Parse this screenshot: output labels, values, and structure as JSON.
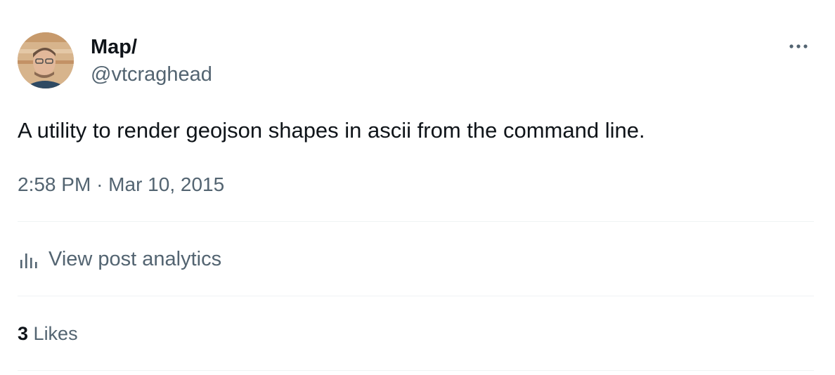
{
  "author": {
    "display_name": "Map/",
    "handle": "@vtcraghead",
    "avatar_icon": "profile-photo"
  },
  "tweet": {
    "text": "A utility to render geojson shapes in ascii from the command line.",
    "time": "2:58 PM",
    "separator": "·",
    "date": "Mar 10, 2015"
  },
  "analytics": {
    "label": "View post analytics",
    "icon": "bar-chart-icon"
  },
  "likes": {
    "count": "3",
    "label": "Likes"
  },
  "menu": {
    "icon": "more-horizontal-icon"
  },
  "colors": {
    "text_primary": "#0f1419",
    "text_secondary": "#536471",
    "divider": "#eff3f4"
  }
}
